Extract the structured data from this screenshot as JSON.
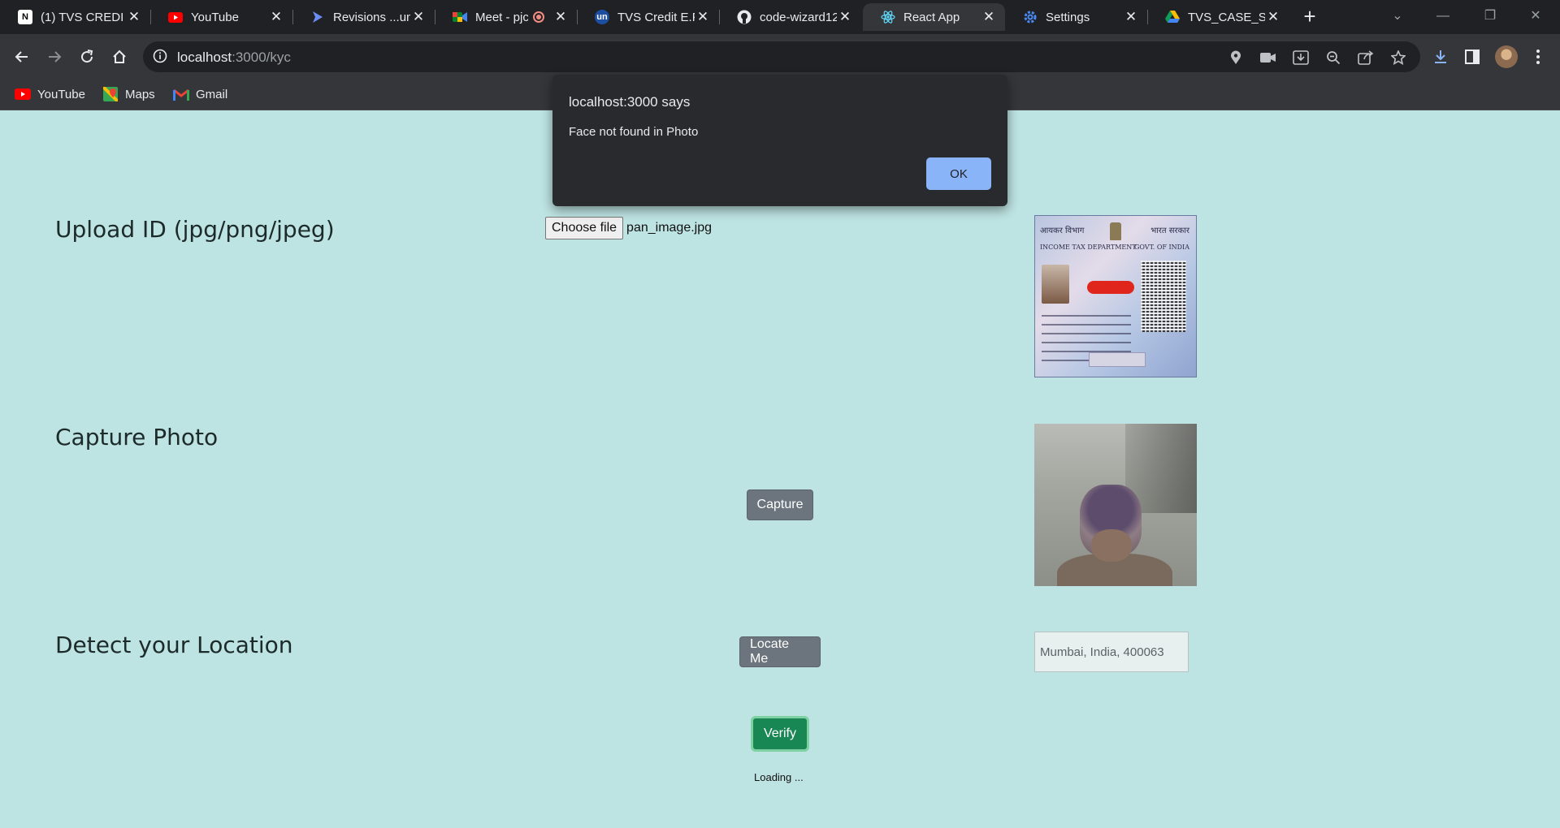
{
  "browser": {
    "tabs": [
      {
        "title": "(1) TVS CREDI",
        "favicon": "notion-icon"
      },
      {
        "title": "YouTube",
        "favicon": "youtube-icon"
      },
      {
        "title": "Revisions ...un",
        "favicon": "revisions-icon"
      },
      {
        "title": "Meet - pjc",
        "favicon": "meet-icon"
      },
      {
        "title": "TVS Credit E.P",
        "favicon": "unstop-icon"
      },
      {
        "title": "code-wizard12",
        "favicon": "github-icon"
      },
      {
        "title": "React App",
        "favicon": "react-icon",
        "active": true
      },
      {
        "title": "Settings",
        "favicon": "gear-icon"
      },
      {
        "title": "TVS_CASE_STU",
        "favicon": "drive-icon"
      }
    ],
    "address": {
      "host": "localhost",
      "path": ":3000/kyc"
    },
    "bookmarks": [
      {
        "label": "YouTube",
        "icon": "youtube-icon"
      },
      {
        "label": "Maps",
        "icon": "maps-icon"
      },
      {
        "label": "Gmail",
        "icon": "gmail-icon"
      }
    ]
  },
  "kyc": {
    "upload_label": "Upload ID (jpg/png/jpeg)",
    "choose_file": "Choose file",
    "file_name": "pan_image.jpg",
    "capture_label": "Capture Photo",
    "capture_button": "Capture",
    "location_label": "Detect your Location",
    "locate_button": "Locate Me",
    "location_value": "Mumbai, India, 400063",
    "verify_button": "Verify",
    "loading_text": "Loading ..."
  },
  "pan_card": {
    "hindi_dept": "आयकर विभाग",
    "hindi_govt": "भारत सरकार",
    "dept": "INCOME TAX DEPARTMENT",
    "govt": "GOVT. OF INDIA"
  },
  "dialog": {
    "origin": "localhost:3000 says",
    "message": "Face not found in Photo",
    "ok": "OK"
  },
  "colors": {
    "page_bg": "#bde3e2",
    "button_grey": "#6c757d",
    "verify_green": "#198754",
    "dialog_ok": "#8ab4f8"
  }
}
